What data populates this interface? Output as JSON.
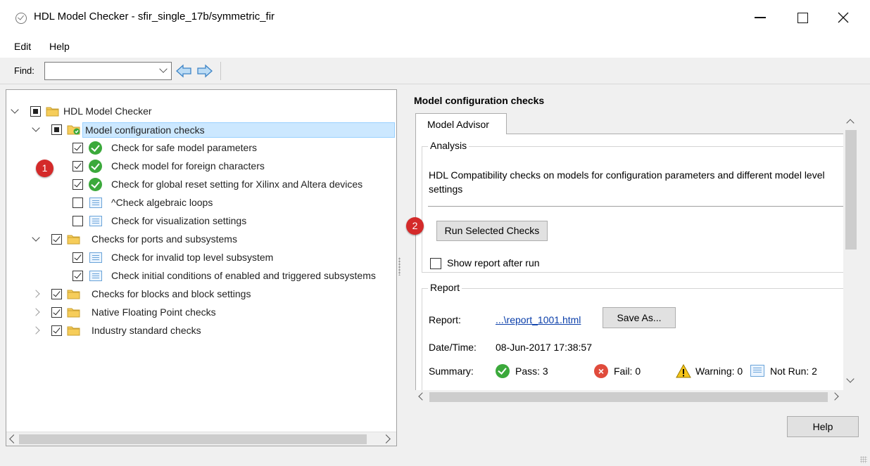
{
  "window": {
    "title": "HDL Model Checker - sfir_single_17b/symmetric_fir"
  },
  "menu": {
    "edit": "Edit",
    "help": "Help"
  },
  "toolbar": {
    "find_label": "Find:",
    "find_value": ""
  },
  "tree": {
    "root": "HDL Model Checker",
    "model_config": "Model configuration checks",
    "check_safe_params": "Check for safe model parameters",
    "check_foreign_chars": "Check model for foreign characters",
    "check_global_reset": "Check for global reset setting for Xilinx and Altera devices",
    "check_algebraic": "^Check algebraic loops",
    "check_visualization": "Check for visualization settings",
    "ports_subsystems": "Checks for ports and subsystems",
    "check_invalid_top": "Check for invalid top level subsystem",
    "check_initial_cond": "Check initial conditions of enabled and triggered subsystems",
    "blocks_settings": "Checks for blocks and block settings",
    "native_fp": "Native Floating Point checks",
    "industry_std": "Industry standard checks"
  },
  "callouts": {
    "one": "1",
    "two": "2"
  },
  "right": {
    "title": "Model configuration checks",
    "tab": "Model Advisor",
    "analysis_title": "Analysis",
    "analysis_desc": "HDL Compatibility checks on models for configuration parameters and different model level settings",
    "run_button": "Run Selected Checks",
    "show_report": "Show report after run",
    "report_title": "Report",
    "report_label": "Report:",
    "report_link": "...\\report_1001.html",
    "save_as": "Save As...",
    "datetime_label": "Date/Time:",
    "datetime_value": "08-Jun-2017 17:38:57",
    "summary_label": "Summary:",
    "pass": "Pass: 3",
    "fail": "Fail: 0",
    "warning": "Warning: 0",
    "not_run": "Not Run: 2"
  },
  "footer": {
    "help": "Help"
  },
  "colors": {
    "pass": "#3ba93b",
    "fail": "#e04b3c",
    "callout": "#d42a2a",
    "selection": "#cce8ff",
    "folder": "#f6cd5a"
  }
}
